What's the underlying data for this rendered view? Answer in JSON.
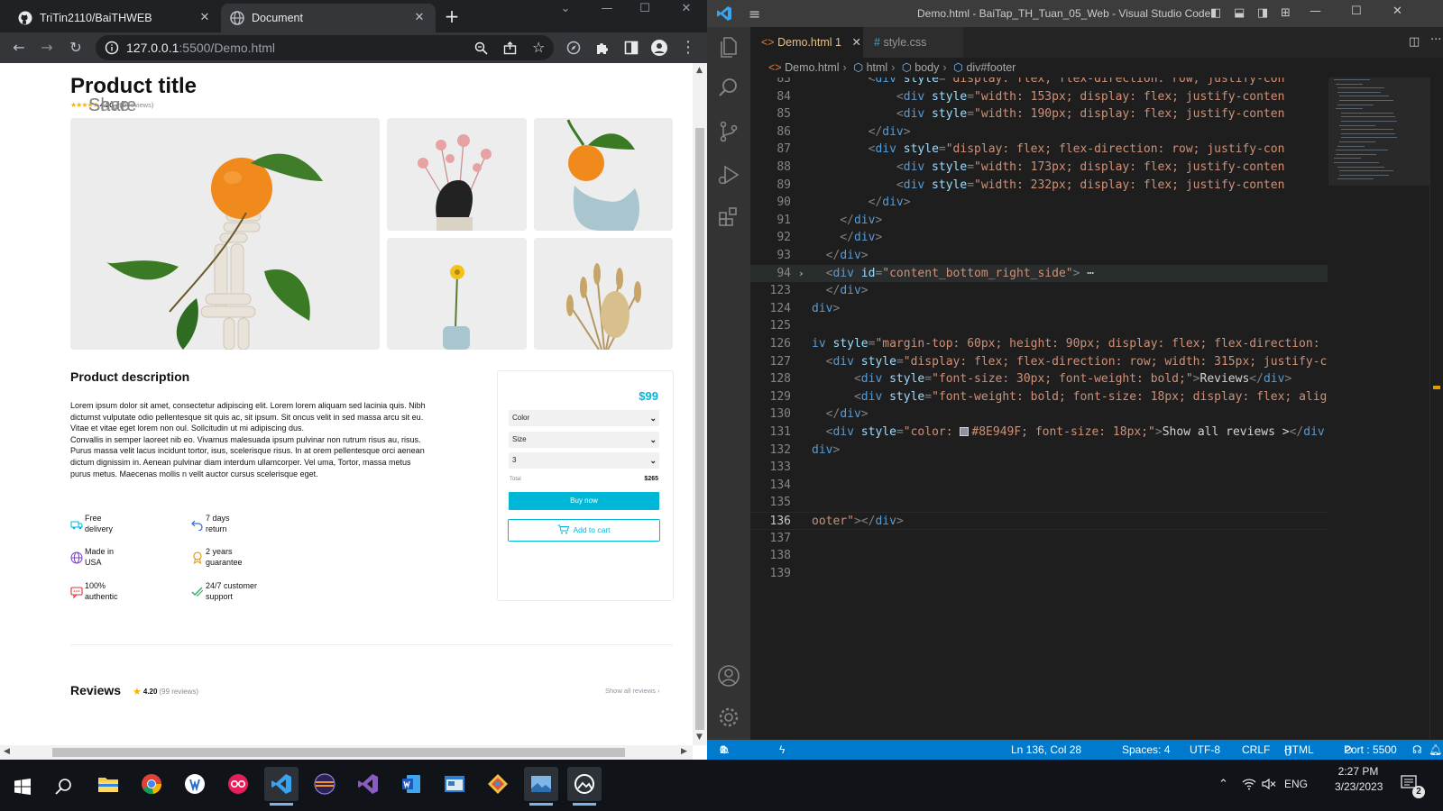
{
  "browser": {
    "tabs": [
      {
        "label": "TriTin2110/BaiTHWEB",
        "icon": "github-icon"
      },
      {
        "label": "Document",
        "icon": "globe-icon"
      }
    ],
    "url_host": "127.0.0.1",
    "url_rest": ":5500/Demo.html"
  },
  "page": {
    "product_title": "Product title",
    "rating": "4.20",
    "reviews_count": "(99 reviews)",
    "share_label": "Share",
    "save_label": "Save",
    "description_title": "Product description",
    "description_text": "Lorem ipsum dolor sit amet, consectetur adipiscing elit. Lorem lorem aliquam sed lacinia quis. Nibh dictumst vulputate odio pellentesque sit quis ac, sit ipsum. Sit oncus velit in sed massa arcu sit eu. Vitae et vitae eget lorem non oul. Sollcitudin ut mi adipiscing dus.\nConvallis in semper laoreet nib eo. Vivamus malesuada ipsum pulvinar non rutrum risus au, risus. Purus massa velit lacus incidunt tortor, isus, scelerisque risus. In at orem pellentesque orci aenean dictum dignissim in. Aenean pulvinar diam interdum ullamcorper. Vel uma, Tortor, massa metus purus metus. Maecenas mollis n vellt auctor cursus scelerisque eget.",
    "features": [
      {
        "icon": "truck-icon",
        "text": "Free delivery"
      },
      {
        "icon": "return-arrow-icon",
        "text": "7 days return"
      },
      {
        "icon": "globe-icon",
        "text": "Made in USA"
      },
      {
        "icon": "award-icon",
        "text": "2 years guarantee"
      },
      {
        "icon": "chat-icon",
        "text": "100% authentic"
      },
      {
        "icon": "check-icon",
        "text": "24/7 customer support"
      }
    ],
    "price": "$99",
    "color_select": "Color",
    "size_select": "Size",
    "quantity_select": "3",
    "total_label": "Total",
    "total_value": "$265",
    "buy_now_label": "Buy now",
    "add_to_cart_label": "Add to cart",
    "reviews_title": "Reviews",
    "reviews_rating": "4.20",
    "show_all_label": "Show all reviews",
    "accent_color": "#00b7d8"
  },
  "vscode": {
    "title": "Demo.html - BaiTap_TH_Tuan_05_Web - Visual Studio Code",
    "tabs": [
      {
        "label": "Demo.html",
        "badge": "1"
      },
      {
        "label": "style.css",
        "icon": "#"
      }
    ],
    "breadcrumb": [
      "Demo.html",
      "html",
      "body",
      "div#footer"
    ],
    "code_lines": [
      {
        "n": "83",
        "tokens": [
          [
            "br",
            "        <"
          ],
          [
            "tag",
            "div"
          ],
          [
            "attr",
            " style"
          ],
          [
            "br",
            "="
          ],
          [
            "str",
            "\"display: flex; flex-direction: row; justify-con"
          ]
        ]
      },
      {
        "n": "84",
        "tokens": [
          [
            "br",
            "            <"
          ],
          [
            "tag",
            "div"
          ],
          [
            "attr",
            " style"
          ],
          [
            "br",
            "="
          ],
          [
            "str",
            "\"width: 153px; display: flex; justify-conten"
          ]
        ]
      },
      {
        "n": "85",
        "tokens": [
          [
            "br",
            "            <"
          ],
          [
            "tag",
            "div"
          ],
          [
            "attr",
            " style"
          ],
          [
            "br",
            "="
          ],
          [
            "str",
            "\"width: 190px; display: flex; justify-conten"
          ]
        ]
      },
      {
        "n": "86",
        "tokens": [
          [
            "br",
            "        </"
          ],
          [
            "tag",
            "div"
          ],
          [
            "br",
            ">"
          ]
        ]
      },
      {
        "n": "87",
        "tokens": [
          [
            "br",
            "        <"
          ],
          [
            "tag",
            "div"
          ],
          [
            "attr",
            " style"
          ],
          [
            "br",
            "="
          ],
          [
            "str",
            "\"display: flex; flex-direction: row; justify-con"
          ]
        ]
      },
      {
        "n": "88",
        "tokens": [
          [
            "br",
            "            <"
          ],
          [
            "tag",
            "div"
          ],
          [
            "attr",
            " style"
          ],
          [
            "br",
            "="
          ],
          [
            "str",
            "\"width: 173px; display: flex; justify-conten"
          ]
        ]
      },
      {
        "n": "89",
        "tokens": [
          [
            "br",
            "            <"
          ],
          [
            "tag",
            "div"
          ],
          [
            "attr",
            " style"
          ],
          [
            "br",
            "="
          ],
          [
            "str",
            "\"width: 232px; display: flex; justify-conten"
          ]
        ]
      },
      {
        "n": "90",
        "tokens": [
          [
            "br",
            "        </"
          ],
          [
            "tag",
            "div"
          ],
          [
            "br",
            ">"
          ]
        ]
      },
      {
        "n": "91",
        "tokens": [
          [
            "br",
            "    </"
          ],
          [
            "tag",
            "div"
          ],
          [
            "br",
            ">"
          ]
        ]
      },
      {
        "n": "92",
        "tokens": [
          [
            "br",
            "    </"
          ],
          [
            "tag",
            "div"
          ],
          [
            "br",
            ">"
          ]
        ]
      },
      {
        "n": "93",
        "tokens": [
          [
            "br",
            "  </"
          ],
          [
            "tag",
            "div"
          ],
          [
            "br",
            ">"
          ]
        ]
      },
      {
        "n": "94",
        "tokens": [
          [
            "br",
            "  <"
          ],
          [
            "tag",
            "div"
          ],
          [
            "attr",
            " id"
          ],
          [
            "br",
            "="
          ],
          [
            "str",
            "\"content_bottom_right_side\""
          ],
          [
            "br",
            "> "
          ],
          [
            "txt",
            "⋯"
          ]
        ]
      },
      {
        "n": "123",
        "tokens": [
          [
            "br",
            "  </"
          ],
          [
            "tag",
            "div"
          ],
          [
            "br",
            ">"
          ]
        ]
      },
      {
        "n": "124",
        "tokens": [
          [
            "tag",
            "div"
          ],
          [
            "br",
            ">"
          ]
        ]
      },
      {
        "n": "125",
        "tokens": []
      },
      {
        "n": "126",
        "tokens": [
          [
            "tag",
            "iv"
          ],
          [
            "attr",
            " style"
          ],
          [
            "br",
            "="
          ],
          [
            "str",
            "\"margin-top: 60px; height: 90px; display: flex; flex-direction: r"
          ]
        ]
      },
      {
        "n": "127",
        "tokens": [
          [
            "br",
            "  <"
          ],
          [
            "tag",
            "div"
          ],
          [
            "attr",
            " style"
          ],
          [
            "br",
            "="
          ],
          [
            "str",
            "\"display: flex; flex-direction: row; width: 315px; justify-c"
          ]
        ]
      },
      {
        "n": "128",
        "tokens": [
          [
            "br",
            "      <"
          ],
          [
            "tag",
            "div"
          ],
          [
            "attr",
            " style"
          ],
          [
            "br",
            "="
          ],
          [
            "str",
            "\"font-size: 30px; font-weight: bold;\""
          ],
          [
            "br",
            ">"
          ],
          [
            "txt",
            "Reviews"
          ],
          [
            "br",
            "</"
          ],
          [
            "tag",
            "div"
          ],
          [
            "br",
            ">"
          ]
        ]
      },
      {
        "n": "129",
        "tokens": [
          [
            "br",
            "      <"
          ],
          [
            "tag",
            "div"
          ],
          [
            "attr",
            " style"
          ],
          [
            "br",
            "="
          ],
          [
            "str",
            "\"font-weight: bold; font-size: 18px; display: flex; alig"
          ]
        ]
      },
      {
        "n": "130",
        "tokens": [
          [
            "br",
            "  </"
          ],
          [
            "tag",
            "div"
          ],
          [
            "br",
            ">"
          ]
        ]
      },
      {
        "n": "131",
        "tokens": [
          [
            "br",
            "  <"
          ],
          [
            "tag",
            "div"
          ],
          [
            "attr",
            " style"
          ],
          [
            "br",
            "="
          ],
          [
            "str",
            "\"color: "
          ],
          [
            "swatch",
            ""
          ],
          [
            "str",
            "#8E949F; font-size: 18px;\""
          ],
          [
            "br",
            ">"
          ],
          [
            "txt",
            "Show all reviews >"
          ],
          [
            "br",
            "</"
          ],
          [
            "tag",
            "div"
          ]
        ]
      },
      {
        "n": "132",
        "tokens": [
          [
            "tag",
            "div"
          ],
          [
            "br",
            ">"
          ]
        ]
      },
      {
        "n": "133",
        "tokens": []
      },
      {
        "n": "134",
        "tokens": []
      },
      {
        "n": "135",
        "tokens": []
      },
      {
        "n": "136",
        "tokens": [
          [
            "str",
            "ooter\""
          ],
          [
            "br",
            "></"
          ],
          [
            "tag",
            "div"
          ],
          [
            "br",
            ">"
          ]
        ]
      },
      {
        "n": "137",
        "tokens": []
      },
      {
        "n": "138",
        "tokens": []
      },
      {
        "n": "139",
        "tokens": []
      }
    ],
    "status": {
      "errors": "0",
      "warnings": "1",
      "position": "Ln 136, Col 28",
      "spaces": "Spaces: 4",
      "encoding": "UTF-8",
      "eol": "CRLF",
      "language": "HTML",
      "port": "Port : 5500"
    }
  },
  "taskbar": {
    "language": "ENG",
    "time": "2:27 PM",
    "date": "3/23/2023",
    "notifications": "2",
    "apps": [
      "windows-start-icon",
      "search-icon",
      "file-explorer-icon",
      "chrome-icon",
      "app-icon",
      "flickr-icon",
      "vscode-icon",
      "eclipse-icon",
      "visual-studio-icon",
      "word-icon",
      "app-window-icon",
      "git-icon",
      "photos-icon",
      "cloud-app-icon"
    ]
  }
}
